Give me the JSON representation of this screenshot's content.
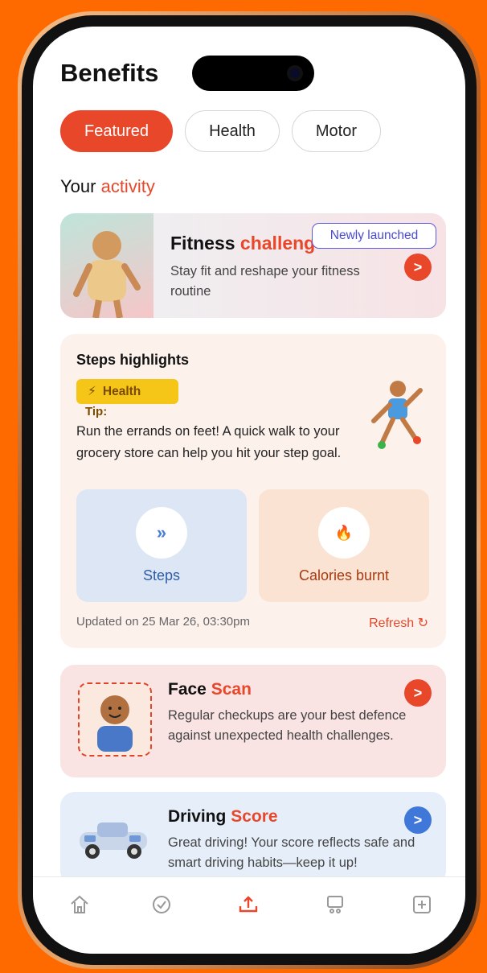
{
  "page": {
    "title": "Benefits"
  },
  "tabs": [
    {
      "label": "Featured",
      "active": true
    },
    {
      "label": "Health",
      "active": false
    },
    {
      "label": "Motor",
      "active": false
    }
  ],
  "section": {
    "prefix": "Your",
    "accent": "activity"
  },
  "fitness": {
    "title_prefix": "Fitness",
    "title_accent": "challeng",
    "badge": "Newly launched",
    "description": "Stay fit and reshape your fitness routine",
    "arrow": ">"
  },
  "steps": {
    "title": "Steps highlights",
    "tag": "Health",
    "tag_icon": "⚡",
    "tip_label": "Tip:",
    "tip_text": "Run the errands on feet! A quick walk to your grocery store can help you hit your step goal.",
    "stats": [
      {
        "label": "Steps",
        "icon": "»"
      },
      {
        "label": "Calories burnt",
        "icon": "🔥"
      }
    ],
    "updated": "Updated on 25 Mar 26, 03:30pm",
    "refresh": "Refresh ↻"
  },
  "face_scan": {
    "title_prefix": "Face",
    "title_accent": "Scan",
    "description": "Regular checkups are your best defence against unexpected health challenges.",
    "arrow": ">"
  },
  "driving": {
    "title_prefix": "Driving",
    "title_accent": "Score",
    "description": "Great driving! Your score reflects safe and smart driving habits—keep it up!",
    "arrow": ">"
  },
  "nav": [
    "home-icon",
    "check-circle-icon",
    "upload-icon",
    "monitor-icon",
    "plus-square-icon"
  ],
  "colors": {
    "accent": "#e8472a",
    "background": "#ff6a00",
    "blue": "#3f78d9"
  }
}
